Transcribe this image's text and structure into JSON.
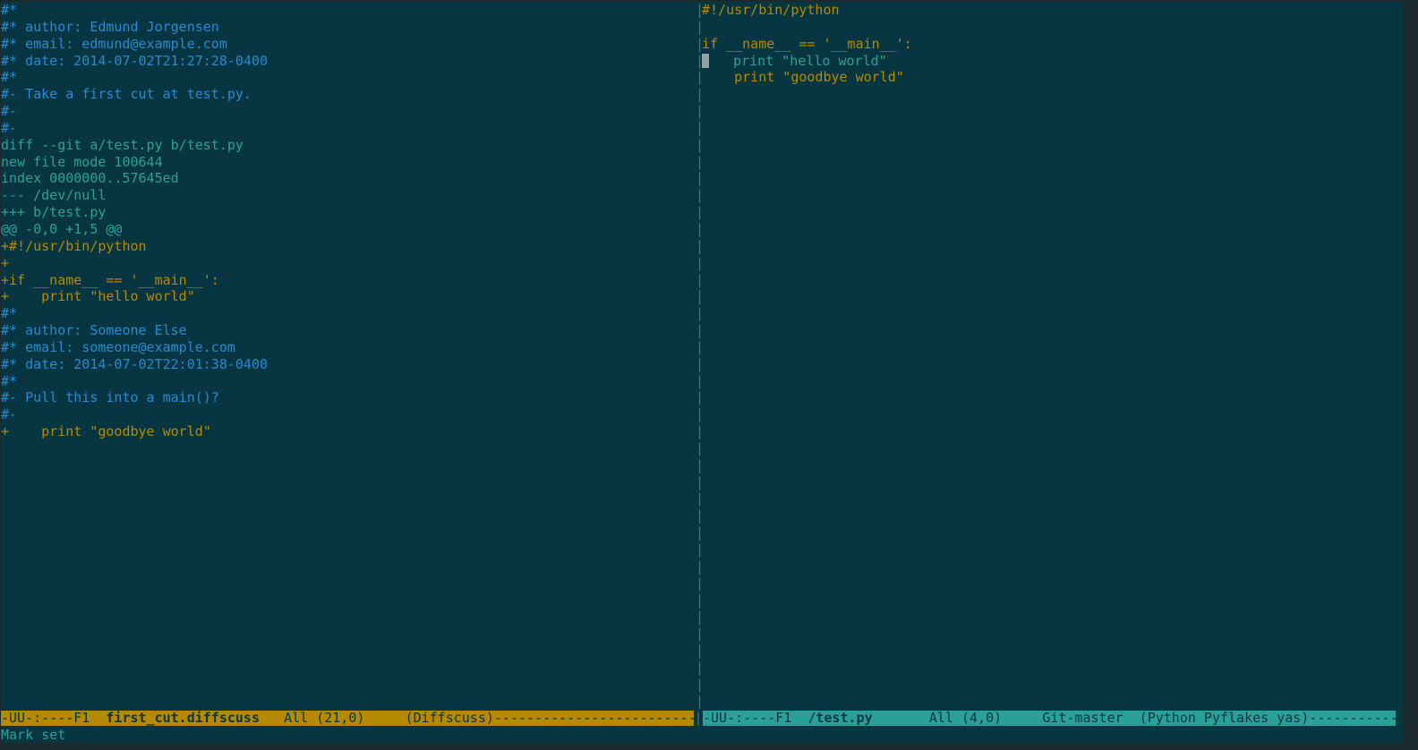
{
  "left_pane": {
    "lines": [
      {
        "text": "#*",
        "kind": "comment"
      },
      {
        "text": "#* author: Edmund Jorgensen",
        "kind": "comment"
      },
      {
        "text": "#* email: edmund@example.com",
        "kind": "comment"
      },
      {
        "text": "#* date: 2014-07-02T21:27:28-0400",
        "kind": "comment"
      },
      {
        "text": "#*",
        "kind": "comment"
      },
      {
        "text": "#- Take a first cut at test.py.",
        "kind": "comment"
      },
      {
        "text": "#-",
        "kind": "comment"
      },
      {
        "text": "#-",
        "kind": "comment"
      },
      {
        "text": "diff --git a/test.py b/test.py",
        "kind": "meta"
      },
      {
        "text": "new file mode 100644",
        "kind": "meta"
      },
      {
        "text": "index 0000000..57645ed",
        "kind": "meta"
      },
      {
        "text": "--- /dev/null",
        "kind": "meta"
      },
      {
        "text": "+++ b/test.py",
        "kind": "meta"
      },
      {
        "text": "@@ -0,0 +1,5 @@",
        "kind": "meta"
      },
      {
        "text": "+#!/usr/bin/python",
        "kind": "add"
      },
      {
        "text": "+",
        "kind": "add"
      },
      {
        "text": "+if __name__ == '__main__':",
        "kind": "add"
      },
      {
        "text": "+    print \"hello world\"",
        "kind": "add"
      },
      {
        "text": "#*",
        "kind": "comment"
      },
      {
        "text": "#* author: Someone Else",
        "kind": "comment"
      },
      {
        "text": "#* email: someone@example.com",
        "kind": "comment"
      },
      {
        "text": "#* date: 2014-07-02T22:01:38-0400",
        "kind": "comment"
      },
      {
        "text": "#*",
        "kind": "comment"
      },
      {
        "text": "#- Pull this into a main()?",
        "kind": "comment"
      },
      {
        "text": "#-",
        "kind": "comment"
      },
      {
        "text": "+    print \"goodbye world\"",
        "kind": "add"
      }
    ]
  },
  "right_pane": {
    "lines": [
      {
        "text": "#!/usr/bin/python",
        "kind": "code"
      },
      {
        "text": "",
        "kind": "code"
      },
      {
        "text": "if __name__ == '__main__':",
        "kind": "code"
      },
      {
        "text": "   print \"hello world\"",
        "kind": "teal",
        "cursor": true
      },
      {
        "text": "    print \"goodbye world\"",
        "kind": "code"
      }
    ]
  },
  "divider": {
    "glyph": "|"
  },
  "modeline_left": {
    "status": "-UU-:----F1  ",
    "buffer": "first_cut.diffscuss",
    "position": "   All (21,0)     ",
    "mode": "(Diffscuss)--------------------------"
  },
  "modeline_right": {
    "status": "-UU-:----F1  ",
    "buffer": "/test.py",
    "position": "       All (4,0)     ",
    "vc": "Git-master  ",
    "mode": "(Python Pyflakes yas)------------"
  },
  "minibuffer": {
    "message": "Mark set"
  },
  "colors": {
    "background": "#073642",
    "comment": "#268bd2",
    "meta": "#2aa198",
    "added": "#b58900",
    "modeline_active": "#b58900",
    "modeline_inactive": "#2aa198"
  }
}
